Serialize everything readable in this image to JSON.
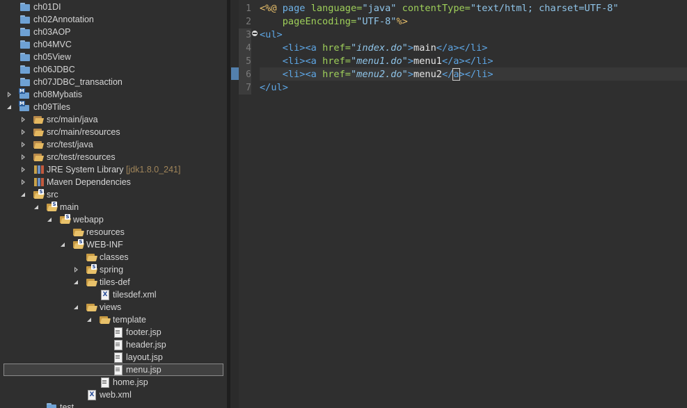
{
  "tree": {
    "items": [
      {
        "label": "ch01DI",
        "icon": "folder-icon"
      },
      {
        "label": "ch02Annotation",
        "icon": "folder-icon"
      },
      {
        "label": "ch03AOP",
        "icon": "folder-icon"
      },
      {
        "label": "ch04MVC",
        "icon": "folder-icon"
      },
      {
        "label": "ch05View",
        "icon": "folder-icon"
      },
      {
        "label": "ch06JDBC",
        "icon": "folder-icon"
      },
      {
        "label": "ch07JDBC_transaction",
        "icon": "folder-icon"
      },
      {
        "label": "ch08Mybatis",
        "icon": "maven-project-icon"
      },
      {
        "label": "ch09Tiles",
        "icon": "maven-project-icon"
      },
      {
        "label": "src/main/java",
        "icon": "source-folder-icon"
      },
      {
        "label": "src/main/resources",
        "icon": "source-folder-icon"
      },
      {
        "label": "src/test/java",
        "icon": "source-folder-icon"
      },
      {
        "label": "src/test/resources",
        "icon": "source-folder-icon"
      },
      {
        "label": "JRE System Library",
        "decoration": "[jdk1.8.0_241]",
        "icon": "library-icon"
      },
      {
        "label": "Maven Dependencies",
        "icon": "library-icon"
      },
      {
        "label": "src",
        "icon": "folder-open-icon"
      },
      {
        "label": "main",
        "icon": "folder-open-icon"
      },
      {
        "label": "webapp",
        "icon": "folder-open-icon"
      },
      {
        "label": "resources",
        "icon": "folder-icon"
      },
      {
        "label": "WEB-INF",
        "icon": "folder-open-icon"
      },
      {
        "label": "classes",
        "icon": "folder-icon"
      },
      {
        "label": "spring",
        "icon": "folder-icon"
      },
      {
        "label": "tiles-def",
        "icon": "folder-open-icon"
      },
      {
        "label": "tilesdef.xml",
        "icon": "xml-file-icon"
      },
      {
        "label": "views",
        "icon": "folder-open-icon"
      },
      {
        "label": "template",
        "icon": "folder-open-icon"
      },
      {
        "label": "footer.jsp",
        "icon": "jsp-file-icon"
      },
      {
        "label": "header.jsp",
        "icon": "jsp-file-icon"
      },
      {
        "label": "layout.jsp",
        "icon": "jsp-file-icon"
      },
      {
        "label": "menu.jsp",
        "icon": "jsp-file-icon"
      },
      {
        "label": "home.jsp",
        "icon": "jsp-file-icon"
      },
      {
        "label": "web.xml",
        "icon": "xml-file-icon"
      },
      {
        "label": "test",
        "icon": "folder-icon"
      }
    ]
  },
  "editor": {
    "line_numbers": [
      "1",
      "2",
      "3",
      "4",
      "5",
      "6",
      "7"
    ],
    "line1": {
      "open": "<%@",
      "kw": "page",
      "a1": "language=",
      "v1": "\"java\"",
      "a2": "contentType=",
      "v2": "\"text/html; charset=UTF-8\""
    },
    "line2": {
      "a1": "pageEncoding=",
      "v1": "\"UTF-8\"",
      "close": "%>"
    },
    "line3": {
      "tag": "<ul>"
    },
    "line4": {
      "li_open": "<li>",
      "a_open": "<a",
      "attr": "href=",
      "val": "\"index.do\"",
      "gt": ">",
      "text": "main",
      "a_close": "</a>",
      "li_close": "</li>"
    },
    "line5": {
      "li_open": "<li>",
      "a_open": "<a",
      "attr": "href=",
      "val": "\"menu1.do\"",
      "gt": ">",
      "text": "menu1",
      "a_close": "</a>",
      "li_close": "</li>"
    },
    "line6": {
      "li_open": "<li>",
      "a_open": "<a",
      "attr": "href=",
      "val": "\"menu2.do\"",
      "gt": ">",
      "text": "menu2",
      "a_close_pre": "</",
      "a_close_a": "a",
      "a_close_post": ">",
      "li_close": "</li>"
    },
    "line7": {
      "tag": "</ul>"
    }
  }
}
